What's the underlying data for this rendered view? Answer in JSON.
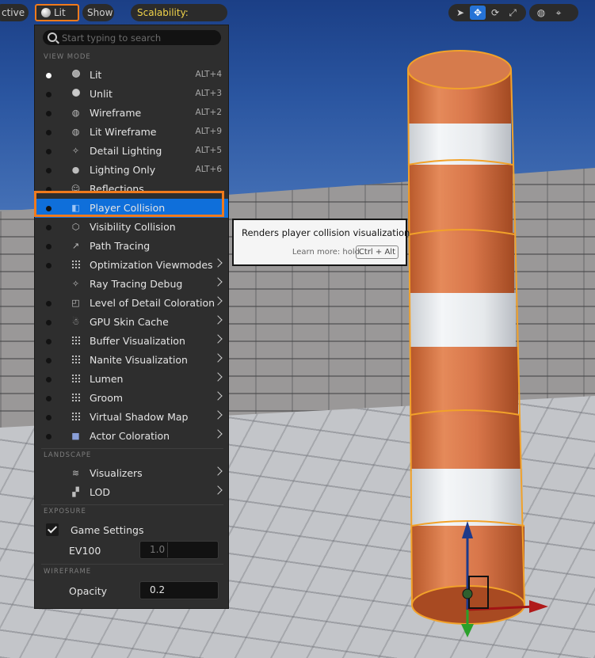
{
  "toolbar": {
    "perspective_partial": "ctive",
    "lit_label": "Lit",
    "show_label": "Show",
    "scalability_label": "Scalability: Medium",
    "accent": "#f07a1c",
    "right_icons": [
      "select-icon",
      "move-icon",
      "rotate-icon",
      "scale-icon",
      "world-icon",
      "snap-icon"
    ]
  },
  "menu": {
    "search_placeholder": "Start typing to search",
    "view_mode_header": "VIEW MODE",
    "items": [
      {
        "label": "Lit",
        "shortcut": "ALT+4",
        "selected": true
      },
      {
        "label": "Unlit",
        "shortcut": "ALT+3"
      },
      {
        "label": "Wireframe",
        "shortcut": "ALT+2"
      },
      {
        "label": "Lit Wireframe",
        "shortcut": "ALT+9"
      },
      {
        "label": "Detail Lighting",
        "shortcut": "ALT+5"
      },
      {
        "label": "Lighting Only",
        "shortcut": "ALT+6"
      },
      {
        "label": "Reflections"
      },
      {
        "label": "Player Collision",
        "highlighted": true
      },
      {
        "label": "Visibility Collision"
      },
      {
        "label": "Path Tracing"
      },
      {
        "label": "Optimization Viewmodes",
        "submenu": true
      },
      {
        "label": "Ray Tracing Debug",
        "submenu": true
      },
      {
        "label": "Level of Detail Coloration",
        "submenu": true
      },
      {
        "label": "GPU Skin Cache",
        "submenu": true
      },
      {
        "label": "Buffer Visualization",
        "submenu": true
      },
      {
        "label": "Nanite Visualization",
        "submenu": true
      },
      {
        "label": "Lumen",
        "submenu": true
      },
      {
        "label": "Groom",
        "submenu": true
      },
      {
        "label": "Virtual Shadow Map",
        "submenu": true
      },
      {
        "label": "Actor Coloration",
        "submenu": true
      }
    ],
    "landscape_header": "LANDSCAPE",
    "landscape_items": [
      {
        "label": "Visualizers",
        "submenu": true
      },
      {
        "label": "LOD",
        "submenu": true
      }
    ],
    "exposure_header": "EXPOSURE",
    "game_settings_label": "Game Settings",
    "game_settings_checked": true,
    "ev100_label": "EV100",
    "ev100_value": "1.0",
    "wireframe_header": "WIREFRAME",
    "opacity_label": "Opacity",
    "opacity_value": "0.2"
  },
  "tooltip": {
    "text": "Renders player collision visualization",
    "learn_more": "Learn more: hold",
    "key": "Ctrl + Alt"
  }
}
